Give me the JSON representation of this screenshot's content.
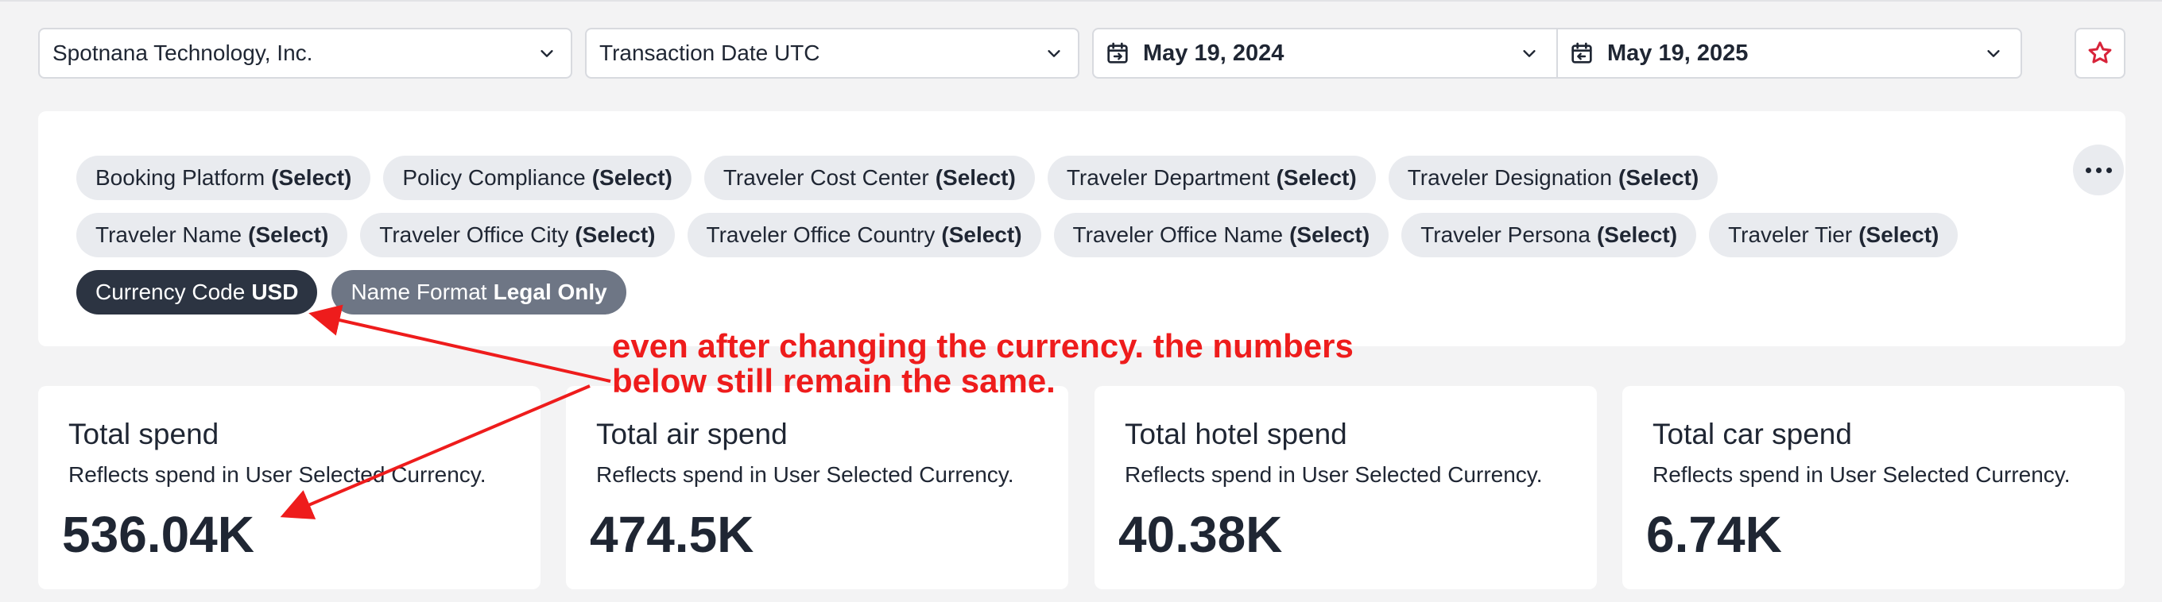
{
  "filters_bar": {
    "company": "Spotnana Technology, Inc.",
    "date_field": "Transaction Date UTC",
    "start_date": "May 19, 2024",
    "end_date": "May 19, 2025"
  },
  "chips": {
    "row1": [
      {
        "name": "Booking Platform",
        "value": "(Select)"
      },
      {
        "name": "Policy Compliance",
        "value": "(Select)"
      },
      {
        "name": "Traveler Cost Center",
        "value": "(Select)"
      },
      {
        "name": "Traveler Department",
        "value": "(Select)"
      },
      {
        "name": "Traveler Designation",
        "value": "(Select)"
      }
    ],
    "row2": [
      {
        "name": "Traveler Name",
        "value": "(Select)"
      },
      {
        "name": "Traveler Office City",
        "value": "(Select)"
      },
      {
        "name": "Traveler Office Country",
        "value": "(Select)"
      },
      {
        "name": "Traveler Office Name",
        "value": "(Select)"
      },
      {
        "name": "Traveler Persona",
        "value": "(Select)"
      },
      {
        "name": "Traveler Tier",
        "value": "(Select)"
      }
    ],
    "row3": [
      {
        "name": "Currency Code",
        "value": "USD"
      },
      {
        "name": "Name Format",
        "value": "Legal Only"
      }
    ]
  },
  "cards": [
    {
      "title": "Total spend",
      "subtitle": "Reflects spend in User Selected Currency.",
      "value": "536.04K"
    },
    {
      "title": "Total air spend",
      "subtitle": "Reflects spend in User Selected Currency.",
      "value": "474.5K"
    },
    {
      "title": "Total hotel spend",
      "subtitle": "Reflects spend in User Selected Currency.",
      "value": "40.38K"
    },
    {
      "title": "Total car spend",
      "subtitle": "Reflects spend in User Selected Currency.",
      "value": "6.74K"
    }
  ],
  "annotation": {
    "text": "even after changing the currency. the numbers\nbelow still remain the same.",
    "color": "#ee1c1c"
  },
  "icons": {
    "select_chevron": "chevron-down-icon",
    "date": "calendar-icon",
    "favorite": "star-icon",
    "more": "more-horizontal-icon"
  },
  "colors": {
    "favorite_star": "#d8243a",
    "active_chip": "#2c3442",
    "secondary_chip": "#6e7685"
  }
}
